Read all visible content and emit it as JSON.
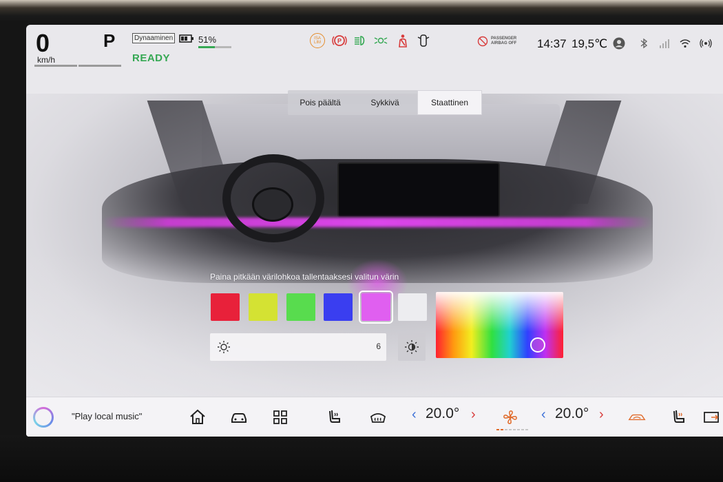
{
  "status": {
    "speed": "0",
    "speed_unit": "km/h",
    "gear": "P",
    "drive_mode": "Dynaaminen",
    "ready": "READY",
    "battery_percent": "51%",
    "battery_level": 0.51,
    "isa_label_top": "ISA",
    "isa_label_bottom": "LIM",
    "airbag_line1": "PASSENGER",
    "airbag_line2": "AIRBAG OFF",
    "time": "14:37",
    "temperature": "19,5℃"
  },
  "tabs": [
    {
      "label": "Pois päältä",
      "active": false
    },
    {
      "label": "Sykkivä",
      "active": false
    },
    {
      "label": "Staattinen",
      "active": true
    }
  ],
  "color_picker": {
    "hint": "Paina pitkään värilohkoa tallentaaksesi valitun värin",
    "swatches": [
      "#e8213a",
      "#d4e233",
      "#58dc4e",
      "#3a3ef0",
      "#e05ff0",
      "#ededf0"
    ],
    "selected_swatch_index": 4,
    "brightness_value": "6"
  },
  "dock": {
    "voice_prompt": "\"Play local music\"",
    "driver_temp": "20.0°",
    "passenger_temp": "20.0°",
    "fan_level": 2
  },
  "colors": {
    "ready_green": "#35a853",
    "ambient_purple": "#dc46eb",
    "warning_orange": "#e58c2a",
    "warning_red": "#d83b3b",
    "temp_blue": "#3b6fd8"
  }
}
